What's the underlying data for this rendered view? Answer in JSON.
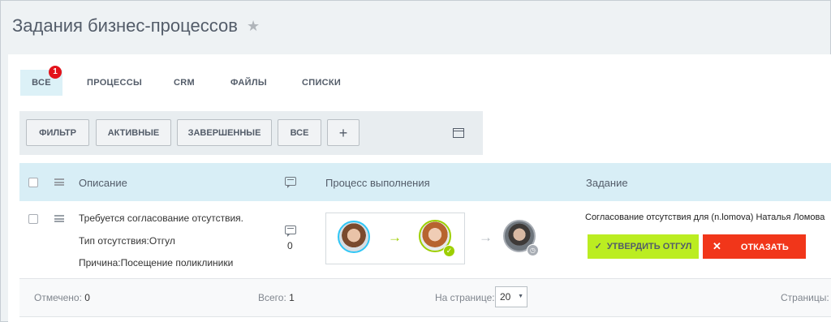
{
  "page": {
    "title": "Задания бизнес-процессов",
    "star_icon": "star-icon"
  },
  "tabs": [
    {
      "label": "ВСЕ",
      "badge": "1",
      "active": true
    },
    {
      "label": "ПРОЦЕССЫ"
    },
    {
      "label": "CRM"
    },
    {
      "label": "ФАЙЛЫ"
    },
    {
      "label": "СПИСКИ"
    }
  ],
  "filters": {
    "buttons": [
      "ФИЛЬТР",
      "АКТИВНЫЕ",
      "ЗАВЕРШЕННЫЕ",
      "ВСЕ"
    ],
    "add_label": "+",
    "panel_icon": "panel-view-icon"
  },
  "table": {
    "headers": {
      "description": "Описание",
      "process": "Процесс выполнения",
      "task": "Задание"
    },
    "rows": [
      {
        "description_lines": [
          "Требуется согласование отсутствия.",
          "Тип отсутствия:Отгул",
          "Причина:Посещение поликлиники"
        ],
        "comments": "0",
        "task_title": "Согласование отсутствия для (n.lomova) Наталья Ломова",
        "approve_label": "УТВЕРДИТЬ ОТГУЛ",
        "decline_label": "ОТКАЗАТЬ"
      }
    ]
  },
  "footer": {
    "marked_label": "Отмечено:",
    "marked_value": "0",
    "total_label": "Всего:",
    "total_value": "1",
    "per_page_label": "На странице:",
    "per_page_value": "20",
    "pages_label": "Страницы:"
  },
  "colors": {
    "approve": "#bbed21",
    "decline": "#f1361a",
    "header_bg": "#d8eef6",
    "badge": "#e3131b"
  }
}
